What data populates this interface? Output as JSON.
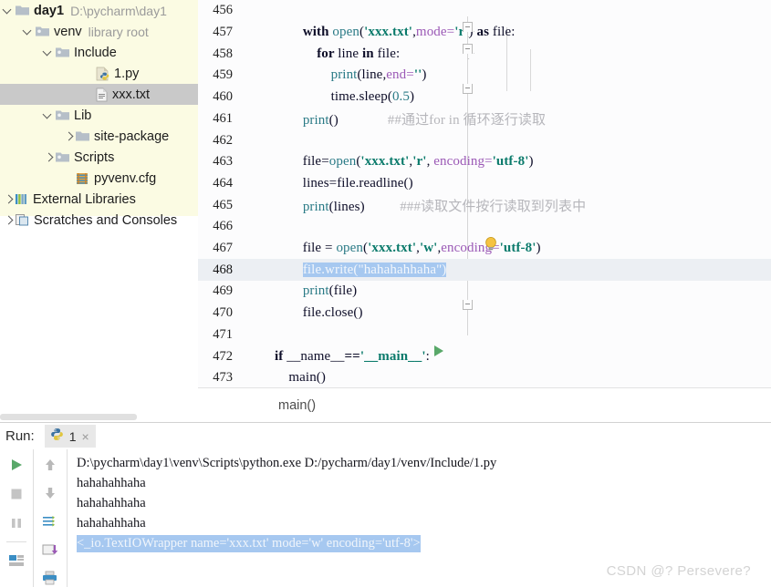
{
  "sidebar": {
    "name": "project-tree",
    "items": [
      {
        "label": "day1",
        "sublabel": "D:\\pycharm\\day1",
        "icon": "folder-icon",
        "indent": 0,
        "twisty": "down",
        "bold": true,
        "selected": false
      },
      {
        "label": "venv",
        "sublabel": "library root",
        "icon": "folder-venv-icon",
        "indent": 1,
        "twisty": "down",
        "bold": false,
        "selected": false
      },
      {
        "label": "Include",
        "sublabel": "",
        "icon": "folder-venv-icon",
        "indent": 2,
        "twisty": "down",
        "bold": false,
        "selected": false
      },
      {
        "label": "1.py",
        "sublabel": "",
        "icon": "python-file-icon",
        "indent": 4,
        "twisty": "none",
        "bold": false,
        "selected": false
      },
      {
        "label": "xxx.txt",
        "sublabel": "",
        "icon": "text-file-icon",
        "indent": 4,
        "twisty": "none",
        "bold": false,
        "selected": true
      },
      {
        "label": "Lib",
        "sublabel": "",
        "icon": "folder-venv-icon",
        "indent": 2,
        "twisty": "down",
        "bold": false,
        "selected": false
      },
      {
        "label": "site-package",
        "sublabel": "",
        "icon": "folder-icon",
        "indent": 3,
        "twisty": "right",
        "bold": false,
        "selected": false
      },
      {
        "label": "Scripts",
        "sublabel": "",
        "icon": "folder-venv-icon",
        "indent": 2,
        "twisty": "right",
        "bold": false,
        "selected": false
      },
      {
        "label": "pyvenv.cfg",
        "sublabel": "",
        "icon": "cfg-file-icon",
        "indent": 3,
        "twisty": "none",
        "bold": false,
        "selected": false
      },
      {
        "label": "External Libraries",
        "sublabel": "",
        "icon": "libraries-icon",
        "indent": 0,
        "twisty": "right",
        "bold": false,
        "selected": false
      },
      {
        "label": "Scratches and Consoles",
        "sublabel": "",
        "icon": "scratches-icon",
        "indent": 0,
        "twisty": "right",
        "bold": false,
        "selected": false
      }
    ]
  },
  "editor": {
    "name": "code-editor",
    "current_line": 468,
    "lines": [
      {
        "num": "456",
        "tokens": []
      },
      {
        "num": "457",
        "tokens": [
          {
            "t": "        ",
            "c": ""
          },
          {
            "t": "with ",
            "c": "kw"
          },
          {
            "t": "open",
            "c": "fn"
          },
          {
            "t": "(",
            "c": ""
          },
          {
            "t": "'xxx.txt'",
            "c": "str"
          },
          {
            "t": ",",
            "c": ""
          },
          {
            "t": "mode=",
            "c": "param"
          },
          {
            "t": "'r'",
            "c": "str"
          },
          {
            "t": ") ",
            "c": ""
          },
          {
            "t": "as ",
            "c": "kw"
          },
          {
            "t": "file:",
            "c": ""
          }
        ]
      },
      {
        "num": "458",
        "tokens": [
          {
            "t": "            ",
            "c": ""
          },
          {
            "t": "for ",
            "c": "kw"
          },
          {
            "t": "line ",
            "c": ""
          },
          {
            "t": "in ",
            "c": "kw"
          },
          {
            "t": "file:",
            "c": ""
          }
        ]
      },
      {
        "num": "459",
        "tokens": [
          {
            "t": "                ",
            "c": ""
          },
          {
            "t": "print",
            "c": "fn"
          },
          {
            "t": "(line,",
            "c": ""
          },
          {
            "t": "end=",
            "c": "param"
          },
          {
            "t": "''",
            "c": "str"
          },
          {
            "t": ")",
            "c": ""
          }
        ]
      },
      {
        "num": "460",
        "tokens": [
          {
            "t": "                time.sleep(",
            "c": ""
          },
          {
            "t": "0.5",
            "c": "num"
          },
          {
            "t": ")",
            "c": ""
          }
        ]
      },
      {
        "num": "461",
        "tokens": [
          {
            "t": "        ",
            "c": ""
          },
          {
            "t": "print",
            "c": "fn"
          },
          {
            "t": "()",
            "c": ""
          },
          {
            "t": "              ",
            "c": ""
          }
        ],
        "comment": "##通过for in 循环逐行读取",
        "comment_italic": "for in"
      },
      {
        "num": "462",
        "tokens": []
      },
      {
        "num": "463",
        "tokens": [
          {
            "t": "        file=",
            "c": ""
          },
          {
            "t": "open",
            "c": "fn"
          },
          {
            "t": "(",
            "c": ""
          },
          {
            "t": "'xxx.txt'",
            "c": "str"
          },
          {
            "t": ",",
            "c": ""
          },
          {
            "t": "'r'",
            "c": "str"
          },
          {
            "t": ", ",
            "c": ""
          },
          {
            "t": "encoding=",
            "c": "param"
          },
          {
            "t": "'utf-8'",
            "c": "str"
          },
          {
            "t": ")",
            "c": ""
          }
        ]
      },
      {
        "num": "464",
        "tokens": [
          {
            "t": "        lines=file.readline()",
            "c": ""
          }
        ]
      },
      {
        "num": "465",
        "tokens": [
          {
            "t": "        ",
            "c": ""
          },
          {
            "t": "print",
            "c": "fn"
          },
          {
            "t": "(lines)",
            "c": ""
          },
          {
            "t": "          ",
            "c": ""
          }
        ],
        "comment": "###读取文件按行读取到列表中"
      },
      {
        "num": "466",
        "tokens": []
      },
      {
        "num": "467",
        "tokens": [
          {
            "t": "        file = ",
            "c": ""
          },
          {
            "t": "open",
            "c": "fn"
          },
          {
            "t": "(",
            "c": ""
          },
          {
            "t": "'xxx.txt'",
            "c": "str"
          },
          {
            "t": ",",
            "c": ""
          },
          {
            "t": "'w'",
            "c": "str"
          },
          {
            "t": ",",
            "c": ""
          },
          {
            "t": "encoding=",
            "c": "param"
          },
          {
            "t": "'utf-8'",
            "c": "str"
          },
          {
            "t": ")",
            "c": ""
          }
        ],
        "bulb": true
      },
      {
        "num": "468",
        "selected_text": "file.write(\"hahahahhaha\")",
        "indent": "        ",
        "tokens": []
      },
      {
        "num": "469",
        "tokens": [
          {
            "t": "        ",
            "c": ""
          },
          {
            "t": "print",
            "c": "fn"
          },
          {
            "t": "(file)",
            "c": ""
          }
        ]
      },
      {
        "num": "470",
        "tokens": [
          {
            "t": "        file.close()",
            "c": ""
          }
        ]
      },
      {
        "num": "471",
        "tokens": []
      },
      {
        "num": "472",
        "tokens": [
          {
            "t": "",
            "c": ""
          },
          {
            "t": "if ",
            "c": "kw"
          },
          {
            "t": "__name__",
            "c": ""
          },
          {
            "t": "==",
            "c": "kw"
          },
          {
            "t": "'__main__'",
            "c": "str"
          },
          {
            "t": ":",
            "c": ""
          }
        ],
        "runmark": true
      },
      {
        "num": "473",
        "tokens": [
          {
            "t": "    main()",
            "c": ""
          }
        ]
      }
    ]
  },
  "breadcrumb": {
    "name": "breadcrumb-bar",
    "text": "main()"
  },
  "run_panel": {
    "name": "run-tool-window",
    "label": "Run:",
    "tab_name": "1",
    "close_label": "×",
    "toolbar_left": [
      {
        "name": "rerun-button",
        "icon": "play-icon"
      },
      {
        "name": "stop-button",
        "icon": "stop-icon"
      },
      {
        "name": "pause-button",
        "icon": "pause-icon"
      },
      {
        "name": "layout-button",
        "icon": "layout-icon"
      }
    ],
    "toolbar_right": [
      {
        "name": "up-stack-button",
        "icon": "arrow-up-icon"
      },
      {
        "name": "down-stack-button",
        "icon": "arrow-down-icon"
      },
      {
        "name": "soft-wrap-button",
        "icon": "soft-wrap-icon"
      },
      {
        "name": "export-button",
        "icon": "export-icon"
      },
      {
        "name": "print-button",
        "icon": "print-icon"
      }
    ],
    "console_lines": [
      {
        "text": "D:\\pycharm\\day1\\venv\\Scripts\\python.exe D:/pycharm/day1/venv/Include/1.py",
        "selected": false
      },
      {
        "text": "hahahahhaha",
        "selected": false
      },
      {
        "text": "hahahahhaha",
        "selected": false
      },
      {
        "text": "hahahahhaha",
        "selected": false
      },
      {
        "text": "<_io.TextIOWrapper name='xxx.txt' mode='w' encoding='utf-8'>",
        "selected": true
      }
    ]
  },
  "watermark": {
    "name": "csdn-watermark",
    "text": "CSDN @? Persevere?"
  },
  "colors": {
    "selection_blue": "#a6c8f0",
    "sidebar_tint": "#fbfbe3",
    "tree_selected": "#c9c9c9",
    "current_line": "#eceff3",
    "run_green": "#59a869",
    "string_green": "#0a7a6b",
    "function_teal": "#2a7a86",
    "param_purple": "#9b59b6",
    "comment_gray": "#b6b6bb"
  }
}
